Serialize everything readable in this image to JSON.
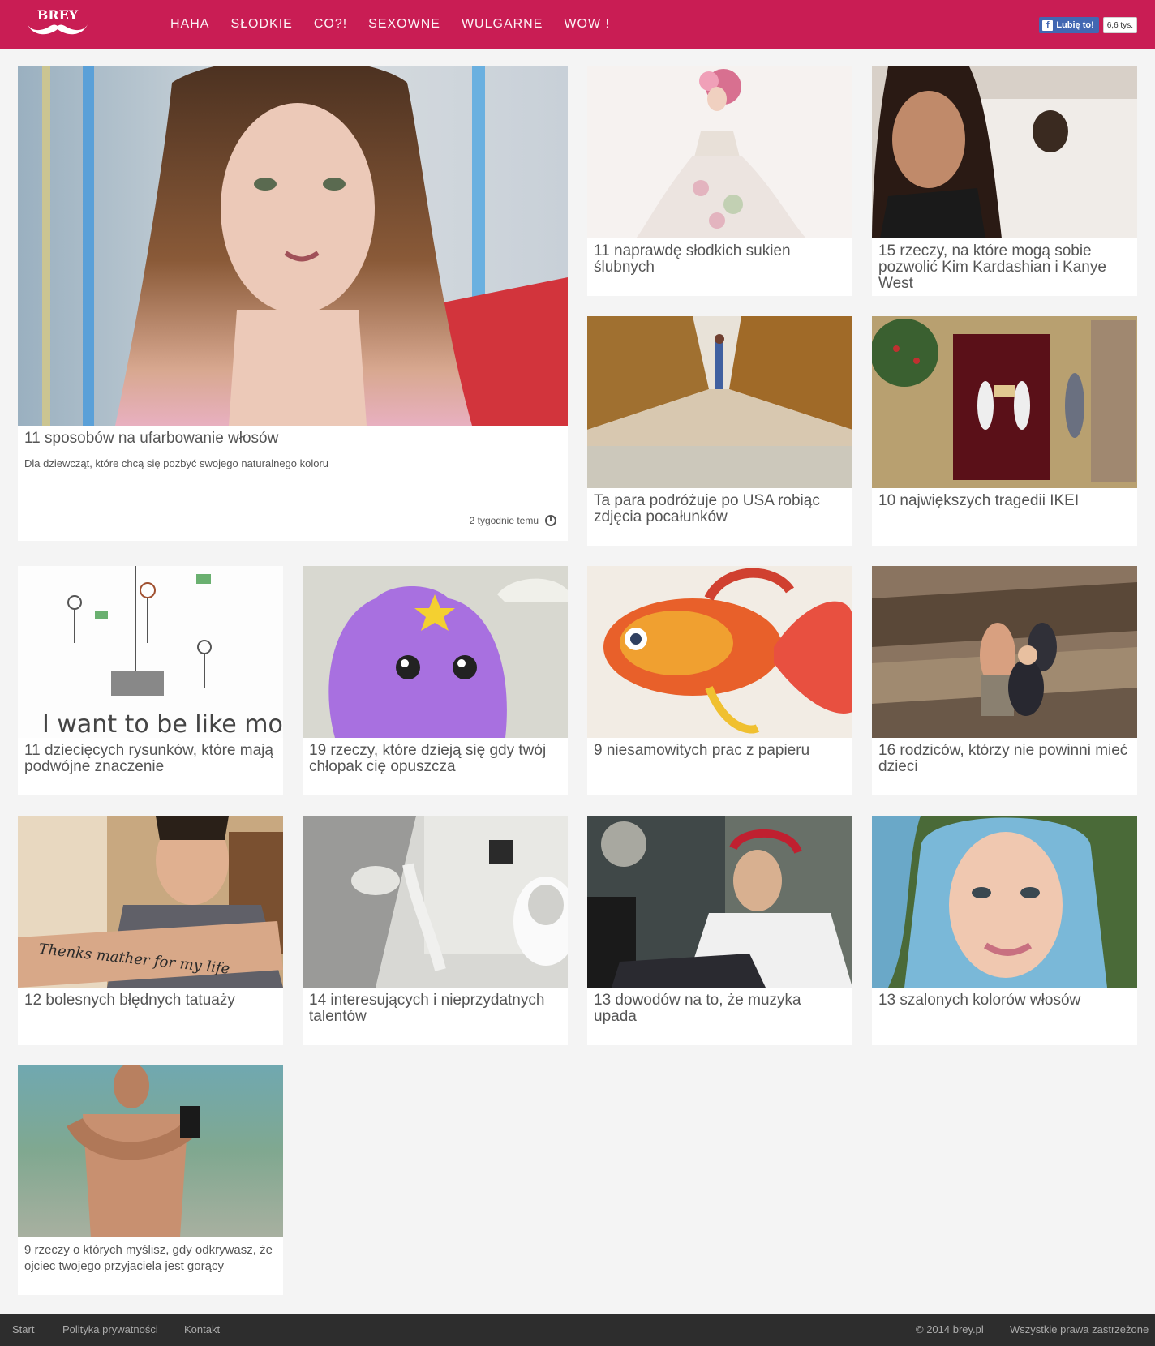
{
  "site": {
    "logo_text": "BREY"
  },
  "nav": [
    {
      "label": "HAHA"
    },
    {
      "label": "SŁODKIE"
    },
    {
      "label": "CO?!"
    },
    {
      "label": "SEXOWNE"
    },
    {
      "label": "WULGARNE"
    },
    {
      "label": "WOW !"
    }
  ],
  "facebook": {
    "button_label": "Lubię to!",
    "count": "6,6 tys."
  },
  "featured": {
    "title": "11 sposobów na ufarbowanie włosów",
    "description": "Dla dziewcząt, które chcą się pozbyć swojego naturalnego koloru",
    "time": "2 tygodnie temu"
  },
  "articles": [
    {
      "title": "11 naprawdę słodkich sukien ślubnych"
    },
    {
      "title": "15 rzeczy, na które mogą sobie pozwolić Kim Kardashian i Kanye West"
    },
    {
      "title": "Ta para podróżuje po USA robiąc zdjęcia pocałunków"
    },
    {
      "title": "10 największych tragedii IKEI"
    },
    {
      "title": "11 dziecięcych rysunków, które mają podwójne znaczenie"
    },
    {
      "title": "19 rzeczy, które dzieją się gdy twój chłopak cię opuszcza"
    },
    {
      "title": "9 niesamowitych prac z papieru"
    },
    {
      "title": "16 rodziców, którzy nie powinni mieć dzieci"
    },
    {
      "title": "12 bolesnych błędnych tatuaży"
    },
    {
      "title": "14 interesujących i nieprzydatnych talentów"
    },
    {
      "title": "13 dowodów na to, że muzyka upada"
    },
    {
      "title": "13 szalonych kolorów włosów"
    },
    {
      "title": "9 rzeczy o których myślisz, gdy odkrywasz, że ojciec twojego przyjaciela jest gorący"
    }
  ],
  "drawing_text": "I want to be like mommy",
  "tattoo_text": "Thenks mather for my life",
  "footer": {
    "links": [
      {
        "label": "Start"
      },
      {
        "label": "Polityka prywatności"
      },
      {
        "label": "Kontakt"
      }
    ],
    "copyright": "© 2014 brey.pl",
    "rights": "Wszystkie prawa zastrzeżone"
  }
}
